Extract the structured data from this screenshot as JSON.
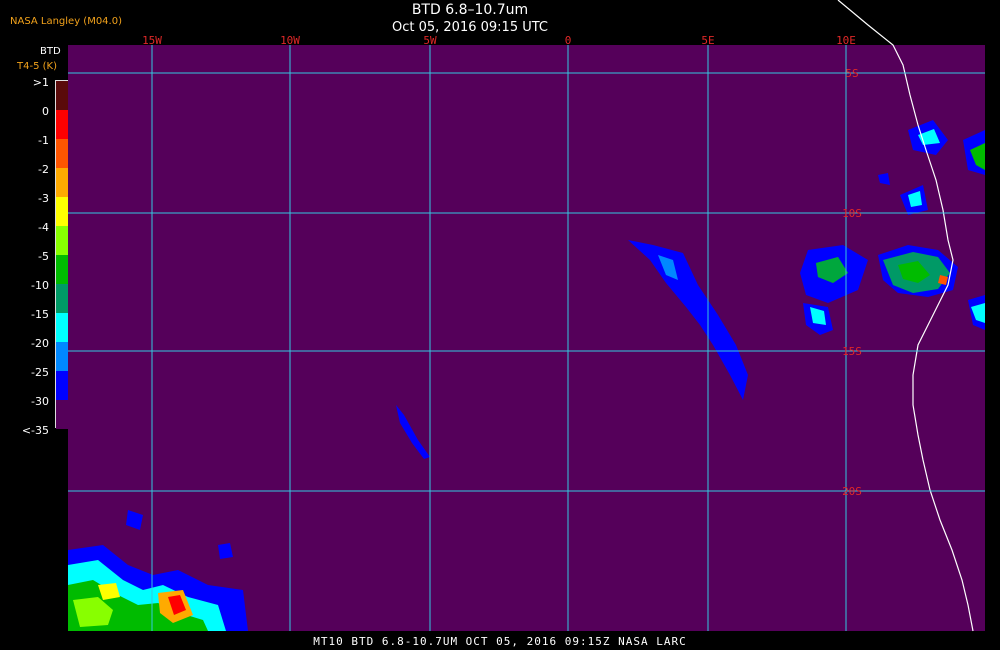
{
  "provider": "NASA Langley (M04.0)",
  "title": "BTD 6.8–10.7um",
  "subtitle": "Oct 05, 2016 09:15 UTC",
  "colorbar": {
    "header": "BTD",
    "units": "T4-5 (K)",
    "labels": [
      ">1",
      "0",
      "-1",
      "-2",
      "-3",
      "-4",
      "-5",
      "-10",
      "-15",
      "-20",
      "-25",
      "-30",
      "<-35"
    ],
    "colors": [
      "#5a0a0a",
      "#ff0000",
      "#ff5500",
      "#ffaa00",
      "#ffff00",
      "#88ff00",
      "#00bb00",
      "#009966",
      "#00ffff",
      "#0088ff",
      "#0000ff",
      "#55005a"
    ]
  },
  "grid": {
    "lon_labels": [
      "15W",
      "10W",
      "5W",
      "0",
      "5E",
      "10E"
    ],
    "lat_labels": [
      "5S",
      "10S",
      "15S",
      "20S"
    ],
    "line_color": "#33c8e0",
    "label_color": "#e02828"
  },
  "map": {
    "background": "#55005a",
    "coast_color": "#ffffff"
  },
  "footer": "MT10  BTD 6.8-10.7UM  OCT 05, 2016 09:15Z  NASA LARC"
}
